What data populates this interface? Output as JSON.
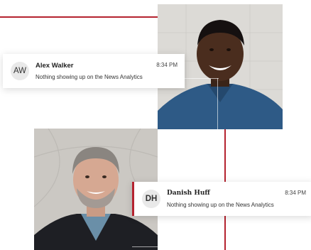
{
  "messages": [
    {
      "initials": "AW",
      "name": "Alex Walker",
      "time": "8:34 PM",
      "text": "Nothing showing up on the News Analytics"
    },
    {
      "initials": "DH",
      "name": "Danish Huff",
      "time": "8:34 PM",
      "text": "Nothing showing up on the News Analytics"
    }
  ],
  "colors": {
    "accent": "#b5232f",
    "shirt": "#2e5a86",
    "blazer": "#1e1f24"
  }
}
